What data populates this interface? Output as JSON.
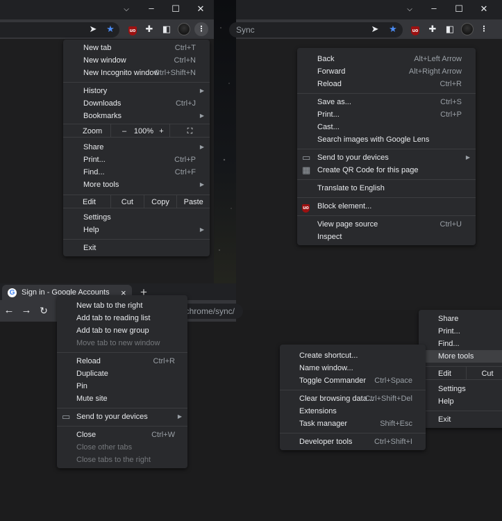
{
  "colors": {
    "menu_bg": "#292a2d",
    "text": "#e8eaed",
    "shortcut": "#9aa0a6",
    "accent_star": "#4c8df6",
    "ublock": "#9c1111"
  },
  "window_left": {
    "icons": [
      "chevron-down-icon",
      "minimize-icon",
      "maximize-icon",
      "close-icon",
      "send-icon",
      "star-icon",
      "ublock-icon",
      "extensions-icon",
      "side-panel-icon",
      "avatar",
      "kebab-menu-icon"
    ]
  },
  "window_right": {
    "omnibox_text": "Sync"
  },
  "tab_window": {
    "tab_title": "Sign in - Google Accounts",
    "omnibox_text": "/chrome/sync/",
    "new_tab": "+",
    "close_tab": "×"
  },
  "main_menu": {
    "items": [
      {
        "label": "New tab",
        "shortcut": "Ctrl+T"
      },
      {
        "label": "New window",
        "shortcut": "Ctrl+N"
      },
      {
        "label": "New Incognito window",
        "shortcut": "Ctrl+Shift+N"
      },
      {
        "sep": true
      },
      {
        "label": "History",
        "submenu": true
      },
      {
        "label": "Downloads",
        "shortcut": "Ctrl+J"
      },
      {
        "label": "Bookmarks",
        "submenu": true
      },
      {
        "zoom": true,
        "label": "Zoom",
        "minus": "–",
        "value": "100%",
        "plus": "+"
      },
      {
        "label": "Share",
        "submenu": true
      },
      {
        "label": "Print...",
        "shortcut": "Ctrl+P"
      },
      {
        "label": "Find...",
        "shortcut": "Ctrl+F"
      },
      {
        "label": "More tools",
        "submenu": true
      },
      {
        "edit": true,
        "label": "Edit",
        "cut": "Cut",
        "copy": "Copy",
        "paste": "Paste"
      },
      {
        "label": "Settings"
      },
      {
        "label": "Help",
        "submenu": true
      },
      {
        "sep": true
      },
      {
        "label": "Exit"
      }
    ]
  },
  "page_context_menu": {
    "items": [
      {
        "label": "Back",
        "shortcut": "Alt+Left Arrow"
      },
      {
        "label": "Forward",
        "shortcut": "Alt+Right Arrow"
      },
      {
        "label": "Reload",
        "shortcut": "Ctrl+R"
      },
      {
        "sep": true
      },
      {
        "label": "Save as...",
        "shortcut": "Ctrl+S"
      },
      {
        "label": "Print...",
        "shortcut": "Ctrl+P"
      },
      {
        "label": "Cast..."
      },
      {
        "label": "Search images with Google Lens"
      },
      {
        "sep": true
      },
      {
        "label": "Send to your devices",
        "submenu": true,
        "icon": "devices-icon"
      },
      {
        "label": "Create QR Code for this page",
        "icon": "qr-code-icon"
      },
      {
        "sep": true
      },
      {
        "label": "Translate to English"
      },
      {
        "sep": true
      },
      {
        "label": "Block element...",
        "icon": "ublock-icon"
      },
      {
        "sep": true
      },
      {
        "label": "View page source",
        "shortcut": "Ctrl+U"
      },
      {
        "label": "Inspect"
      }
    ]
  },
  "tab_context_menu": {
    "items": [
      {
        "label": "New tab to the right"
      },
      {
        "label": "Add tab to reading list"
      },
      {
        "label": "Add tab to new group"
      },
      {
        "label": "Move tab to new window",
        "disabled": true
      },
      {
        "sep": true
      },
      {
        "label": "Reload",
        "shortcut": "Ctrl+R"
      },
      {
        "label": "Duplicate"
      },
      {
        "label": "Pin"
      },
      {
        "label": "Mute site"
      },
      {
        "sep": true
      },
      {
        "label": "Send to your devices",
        "submenu": true,
        "icon": "devices-icon"
      },
      {
        "sep": true
      },
      {
        "label": "Close",
        "shortcut": "Ctrl+W"
      },
      {
        "label": "Close other tabs",
        "disabled": true
      },
      {
        "label": "Close tabs to the right",
        "disabled": true
      }
    ]
  },
  "partial_main_menu": {
    "items": [
      {
        "label": "Share"
      },
      {
        "label": "Print..."
      },
      {
        "label": "Find..."
      },
      {
        "label": "More tools",
        "highlighted": true
      },
      {
        "edit": true,
        "label": "Edit",
        "cut": "Cut"
      },
      {
        "label": "Settings"
      },
      {
        "label": "Help"
      },
      {
        "sep": true
      },
      {
        "label": "Exit"
      }
    ]
  },
  "more_tools_submenu": {
    "items": [
      {
        "label": "Create shortcut..."
      },
      {
        "label": "Name window..."
      },
      {
        "label": "Toggle Commander",
        "shortcut": "Ctrl+Space"
      },
      {
        "sep": true
      },
      {
        "label": "Clear browsing data...",
        "shortcut": "Ctrl+Shift+Del"
      },
      {
        "label": "Extensions"
      },
      {
        "label": "Task manager",
        "shortcut": "Shift+Esc"
      },
      {
        "sep": true
      },
      {
        "label": "Developer tools",
        "shortcut": "Ctrl+Shift+I"
      }
    ]
  }
}
